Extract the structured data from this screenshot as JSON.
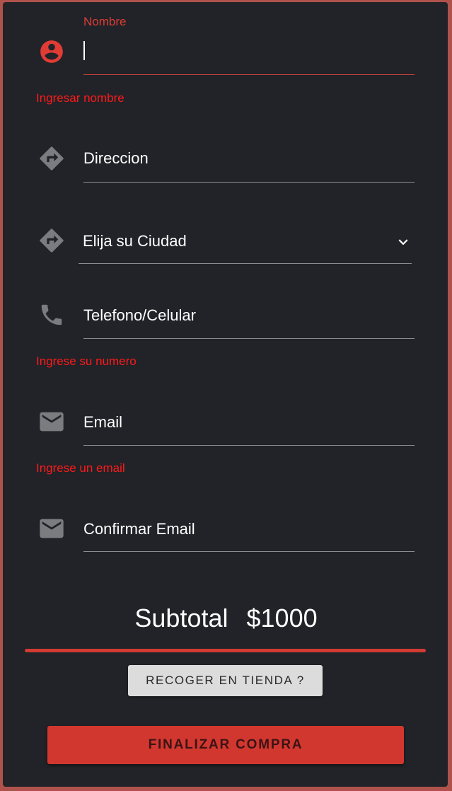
{
  "form": {
    "nombre": {
      "label": "Nombre",
      "value": "",
      "error": "Ingresar nombre"
    },
    "direccion": {
      "placeholder": "Direccion"
    },
    "ciudad": {
      "selected": "Elija su Ciudad"
    },
    "telefono": {
      "placeholder": "Telefono/Celular",
      "error": "Ingrese su numero"
    },
    "email": {
      "placeholder": "Email",
      "error": "Ingrese un email"
    },
    "confirmar_email": {
      "placeholder": "Confirmar Email"
    }
  },
  "summary": {
    "subtotal_label": "Subtotal",
    "subtotal_value": "$1000"
  },
  "actions": {
    "pickup_label": "RECOGER EN TIENDA ?",
    "finish_label": "FINALIZAR COMPRA"
  },
  "icons": {
    "nombre": "account-circle-icon",
    "direccion": "directions-icon",
    "ciudad": "directions-icon",
    "telefono": "phone-icon",
    "email": "email-icon",
    "confirmar_email": "email-icon",
    "dropdown": "chevron-down-icon"
  },
  "colors": {
    "accent": "#d2372f",
    "error": "#ff1a1a",
    "background": "#212328",
    "frame": "#b0524c"
  }
}
